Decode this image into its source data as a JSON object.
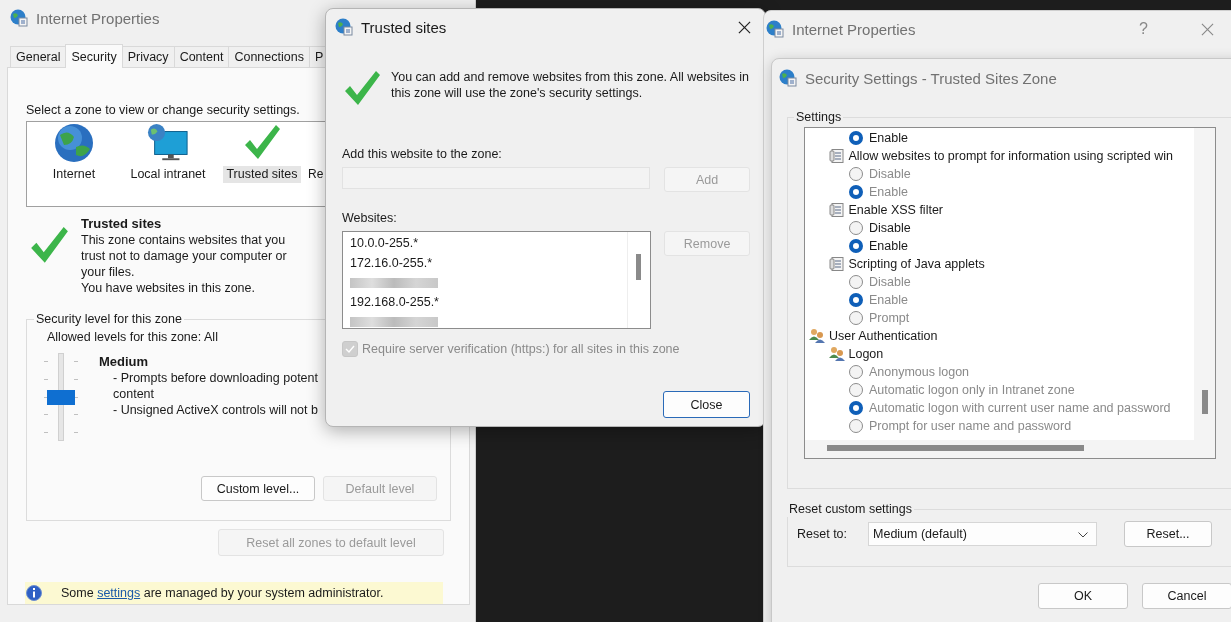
{
  "left_window": {
    "title": "Internet Properties",
    "tabs": [
      {
        "label": "General",
        "selected": false
      },
      {
        "label": "Security",
        "selected": true
      },
      {
        "label": "Privacy",
        "selected": false
      },
      {
        "label": "Content",
        "selected": false
      },
      {
        "label": "Connections",
        "selected": false
      },
      {
        "label": "P",
        "selected": false
      }
    ],
    "zone_prompt": "Select a zone to view or change security settings.",
    "zones": [
      {
        "label": "Internet",
        "kind": "globe",
        "selected": false
      },
      {
        "label": "Local intranet",
        "kind": "intranet",
        "selected": false
      },
      {
        "label": "Trusted sites",
        "kind": "trusted",
        "selected": true
      },
      {
        "label": "Re",
        "kind": "none",
        "selected": false
      }
    ],
    "zone_info": {
      "title": "Trusted sites",
      "description": "This zone contains websites that you trust not to damage your computer or your files.",
      "note": "You have websites in this zone."
    },
    "security_level": {
      "legend": "Security level for this zone",
      "allowed": "Allowed levels for this zone: All",
      "level": 0.5,
      "name": "Medium",
      "lines": [
        "- Prompts before downloading potent",
        "content",
        "- Unsigned ActiveX controls will not b"
      ],
      "buttons": [
        {
          "label": "Custom level...",
          "disabled": false
        },
        {
          "label": "Default level",
          "disabled": true
        }
      ]
    },
    "reset_all": {
      "label": "Reset all zones to default level",
      "disabled": true
    },
    "notice": {
      "before": "Some",
      "link": "settings",
      "after": "are managed by your system administrator."
    }
  },
  "trusted_sites_dialog": {
    "title": "Trusted sites",
    "message": "You can add and remove websites from this zone. All websites in this zone will use the zone's security settings.",
    "add_label": "Add this website to the zone:",
    "add_button": {
      "label": "Add",
      "disabled": true
    },
    "websites_label": "Websites:",
    "websites": [
      {
        "kind": "address",
        "text": "10.0.0-255.*"
      },
      {
        "kind": "address",
        "text": "172.16.0-255.*"
      },
      {
        "kind": "redacted"
      },
      {
        "kind": "address",
        "text": "192.168.0-255.*"
      },
      {
        "kind": "redacted"
      }
    ],
    "remove_button": {
      "label": "Remove",
      "disabled": true
    },
    "require_https": {
      "label": "Require server verification (https:) for all sites in this zone",
      "checked": true,
      "disabled": true
    },
    "close_button": "Close"
  },
  "back_window": {
    "title": "Internet Properties",
    "help": "?"
  },
  "security_settings": {
    "title": "Security Settings - Trusted Sites Zone",
    "settings_legend": "Settings",
    "tree": [
      {
        "kind": "category",
        "children": [
          {
            "kind": "setting",
            "children": [
              {
                "kind": "radio",
                "label": "Enable",
                "selected": true,
                "disabled": false
              }
            ]
          },
          {
            "kind": "setting",
            "label": "Allow websites to prompt for information using scripted win",
            "children": [
              {
                "kind": "radio",
                "label": "Disable",
                "selected": false,
                "disabled": true
              },
              {
                "kind": "radio",
                "label": "Enable",
                "selected": true,
                "disabled": true
              }
            ]
          },
          {
            "kind": "setting",
            "label": "Enable XSS filter",
            "children": [
              {
                "kind": "radio",
                "label": "Disable",
                "selected": false,
                "disabled": false
              },
              {
                "kind": "radio",
                "label": "Enable",
                "selected": true,
                "disabled": false
              }
            ]
          },
          {
            "kind": "setting",
            "label": "Scripting of Java applets",
            "children": [
              {
                "kind": "radio",
                "label": "Disable",
                "selected": false,
                "disabled": true
              },
              {
                "kind": "radio",
                "label": "Enable",
                "selected": true,
                "disabled": true
              },
              {
                "kind": "radio",
                "label": "Prompt",
                "selected": false,
                "disabled": true
              }
            ]
          }
        ]
      },
      {
        "kind": "category",
        "label": "User Authentication",
        "children": [
          {
            "kind": "category",
            "label": "Logon",
            "children": [
              {
                "kind": "radio",
                "label": "Anonymous logon",
                "selected": false,
                "disabled": true
              },
              {
                "kind": "radio",
                "label": "Automatic logon only in Intranet zone",
                "selected": false,
                "disabled": true
              },
              {
                "kind": "radio",
                "label": "Automatic logon with current user name and password",
                "selected": true,
                "disabled": true
              },
              {
                "kind": "radio",
                "label": "Prompt for user name and password",
                "selected": false,
                "disabled": true
              }
            ]
          }
        ]
      }
    ],
    "reset_legend": "Reset custom settings",
    "reset_to_label": "Reset to:",
    "reset_to_value": "Medium (default)",
    "reset_button": "Reset...",
    "ok_button": "OK",
    "cancel_button": "Cancel"
  }
}
